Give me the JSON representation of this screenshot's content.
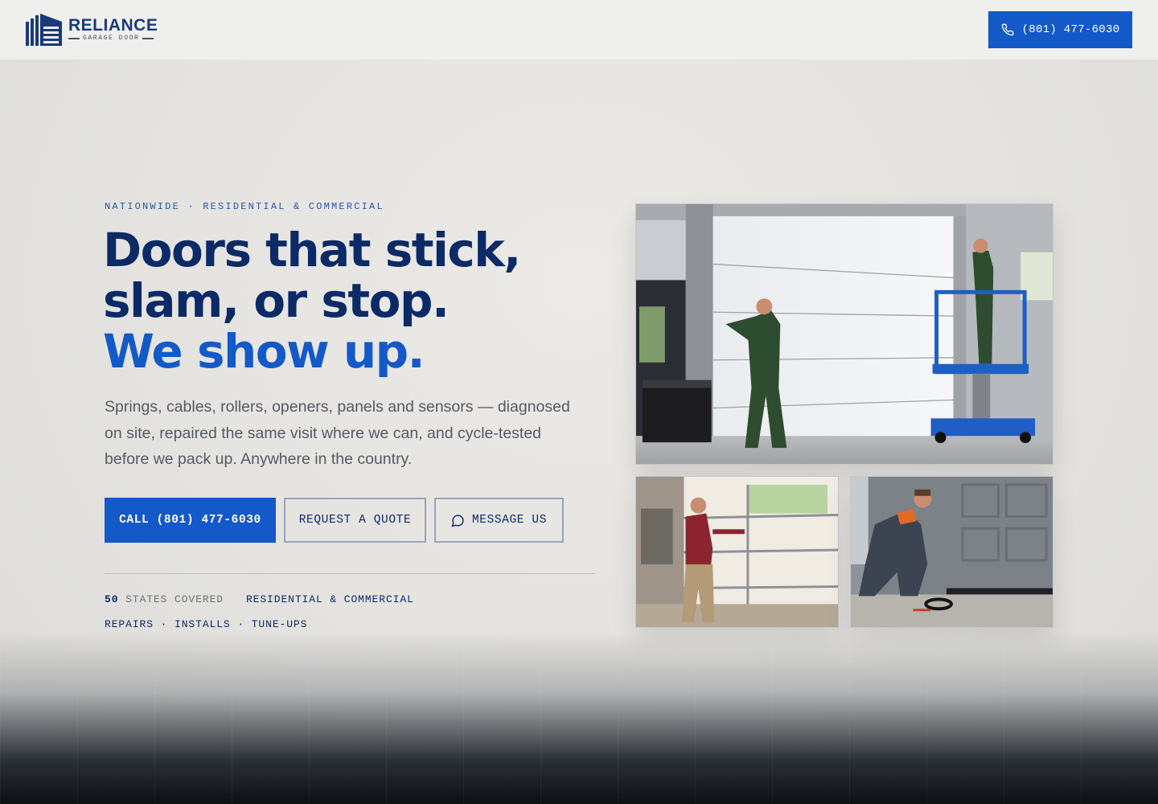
{
  "header": {
    "logo_title": "RELIANCE",
    "logo_subtitle": "GARAGE DOOR",
    "phone_label": "(801) 477-6030",
    "phone_icon": "phone-icon",
    "bg": "#efefed"
  },
  "hero": {
    "eyebrow": "NATIONWIDE · RESIDENTIAL & COMMERCIAL",
    "headline_line1": "Doors that stick,",
    "headline_line2": "slam, or stop.",
    "headline_accent": "We show up.",
    "lede": "Springs, cables, rollers, openers, panels and sensors — diagnosed on site, repaired the same visit where we can, and cycle-tested before we pack up. Anywhere in the country.",
    "buttons": {
      "call": "CALL (801) 477-6030",
      "quote": "REQUEST A QUOTE",
      "message": "MESSAGE US",
      "message_icon": "chat-bubble-icon"
    },
    "stats": {
      "states_number": "50",
      "states_label": "STATES COVERED",
      "segments": "RESIDENTIAL & COMMERCIAL",
      "services": "REPAIRS · INSTALLS · TUNE-UPS"
    }
  },
  "photos": [
    {
      "name": "technicians-installing-commercial-door"
    },
    {
      "name": "technician-fixing-glass-panel-door"
    },
    {
      "name": "technician-kneeling-at-door-seal"
    }
  ],
  "colors": {
    "brand_navy": "#0b2a66",
    "brand_blue": "#1459c8",
    "text_muted": "#555a63",
    "page_bg": "#e6e5e3"
  }
}
